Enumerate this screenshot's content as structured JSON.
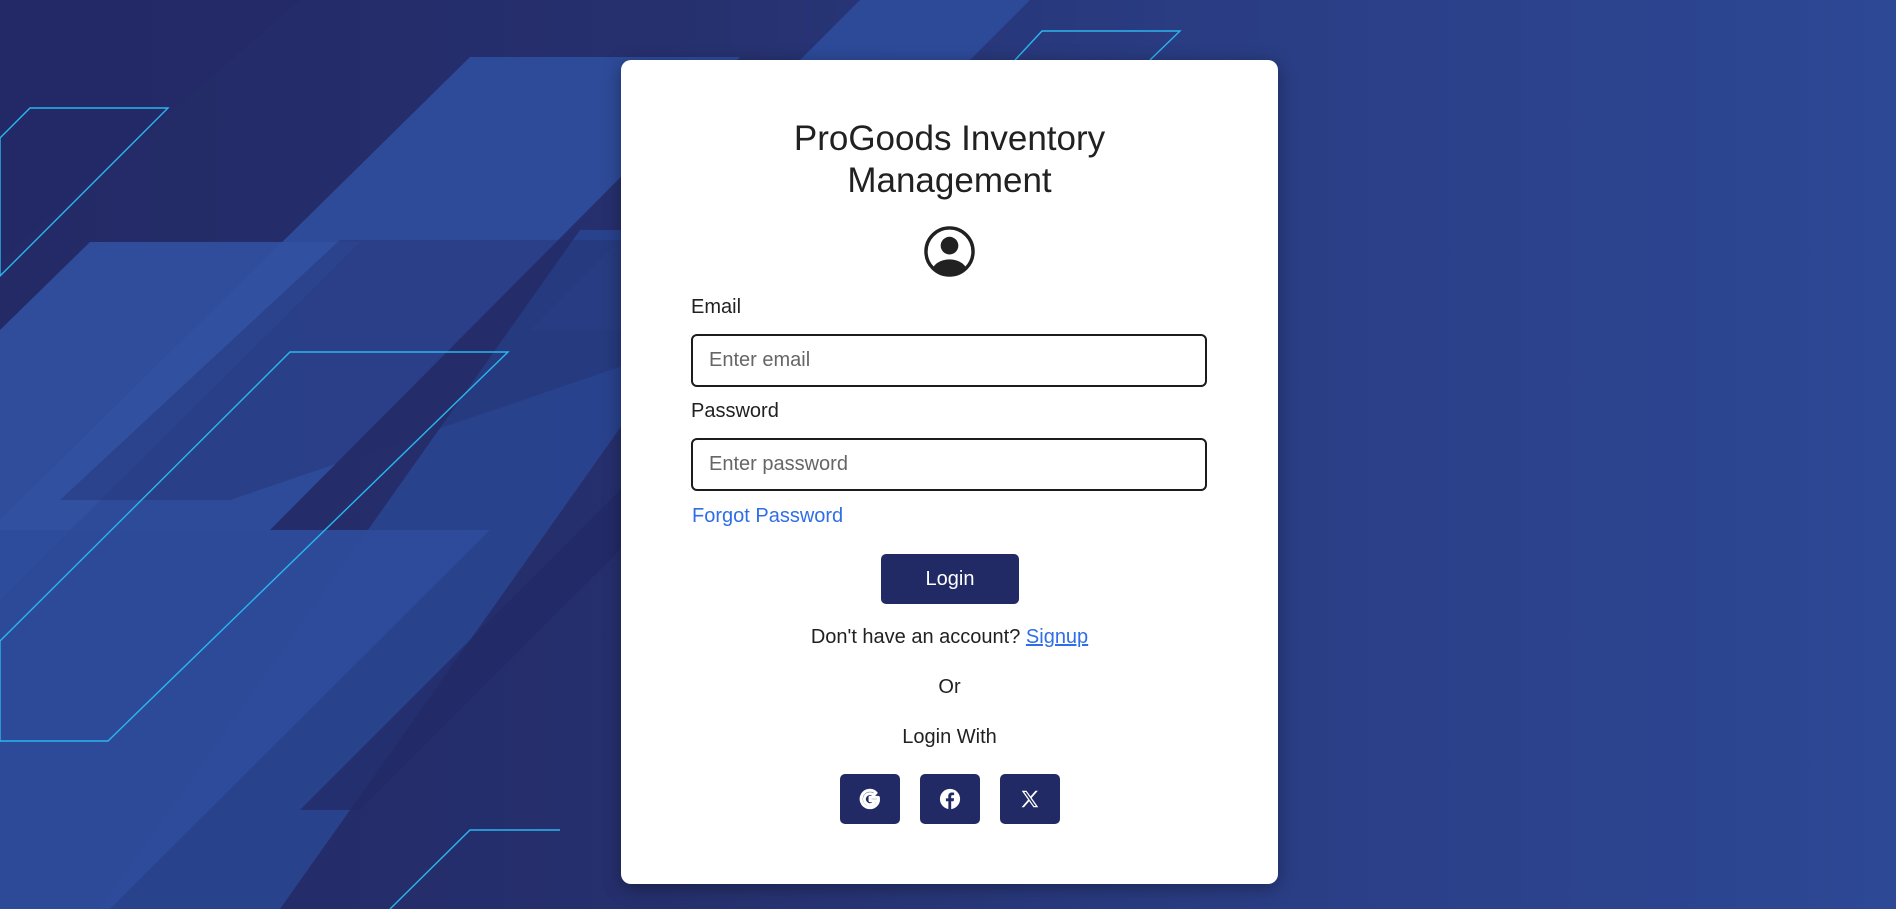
{
  "app": {
    "title_line1": "ProGoods Inventory",
    "title_line2": "Management"
  },
  "form": {
    "email_label": "Email",
    "email_placeholder": "Enter email",
    "email_value": "",
    "password_label": "Password",
    "password_placeholder": "Enter password",
    "password_value": "",
    "forgot_password": "Forgot Password",
    "login_button": "Login",
    "no_account_text": "Don't have an account?",
    "signup_link": "Signup",
    "or_text": "Or",
    "login_with_text": "Login With"
  },
  "social": [
    {
      "name": "google",
      "icon": "google-icon"
    },
    {
      "name": "facebook",
      "icon": "facebook-icon"
    },
    {
      "name": "x",
      "icon": "x-icon"
    }
  ],
  "colors": {
    "primary_button": "#222a66",
    "link": "#2f6ee6",
    "background_dark": "#232a66",
    "background_light": "#2d4895",
    "accent_line": "#2ab6ee"
  }
}
